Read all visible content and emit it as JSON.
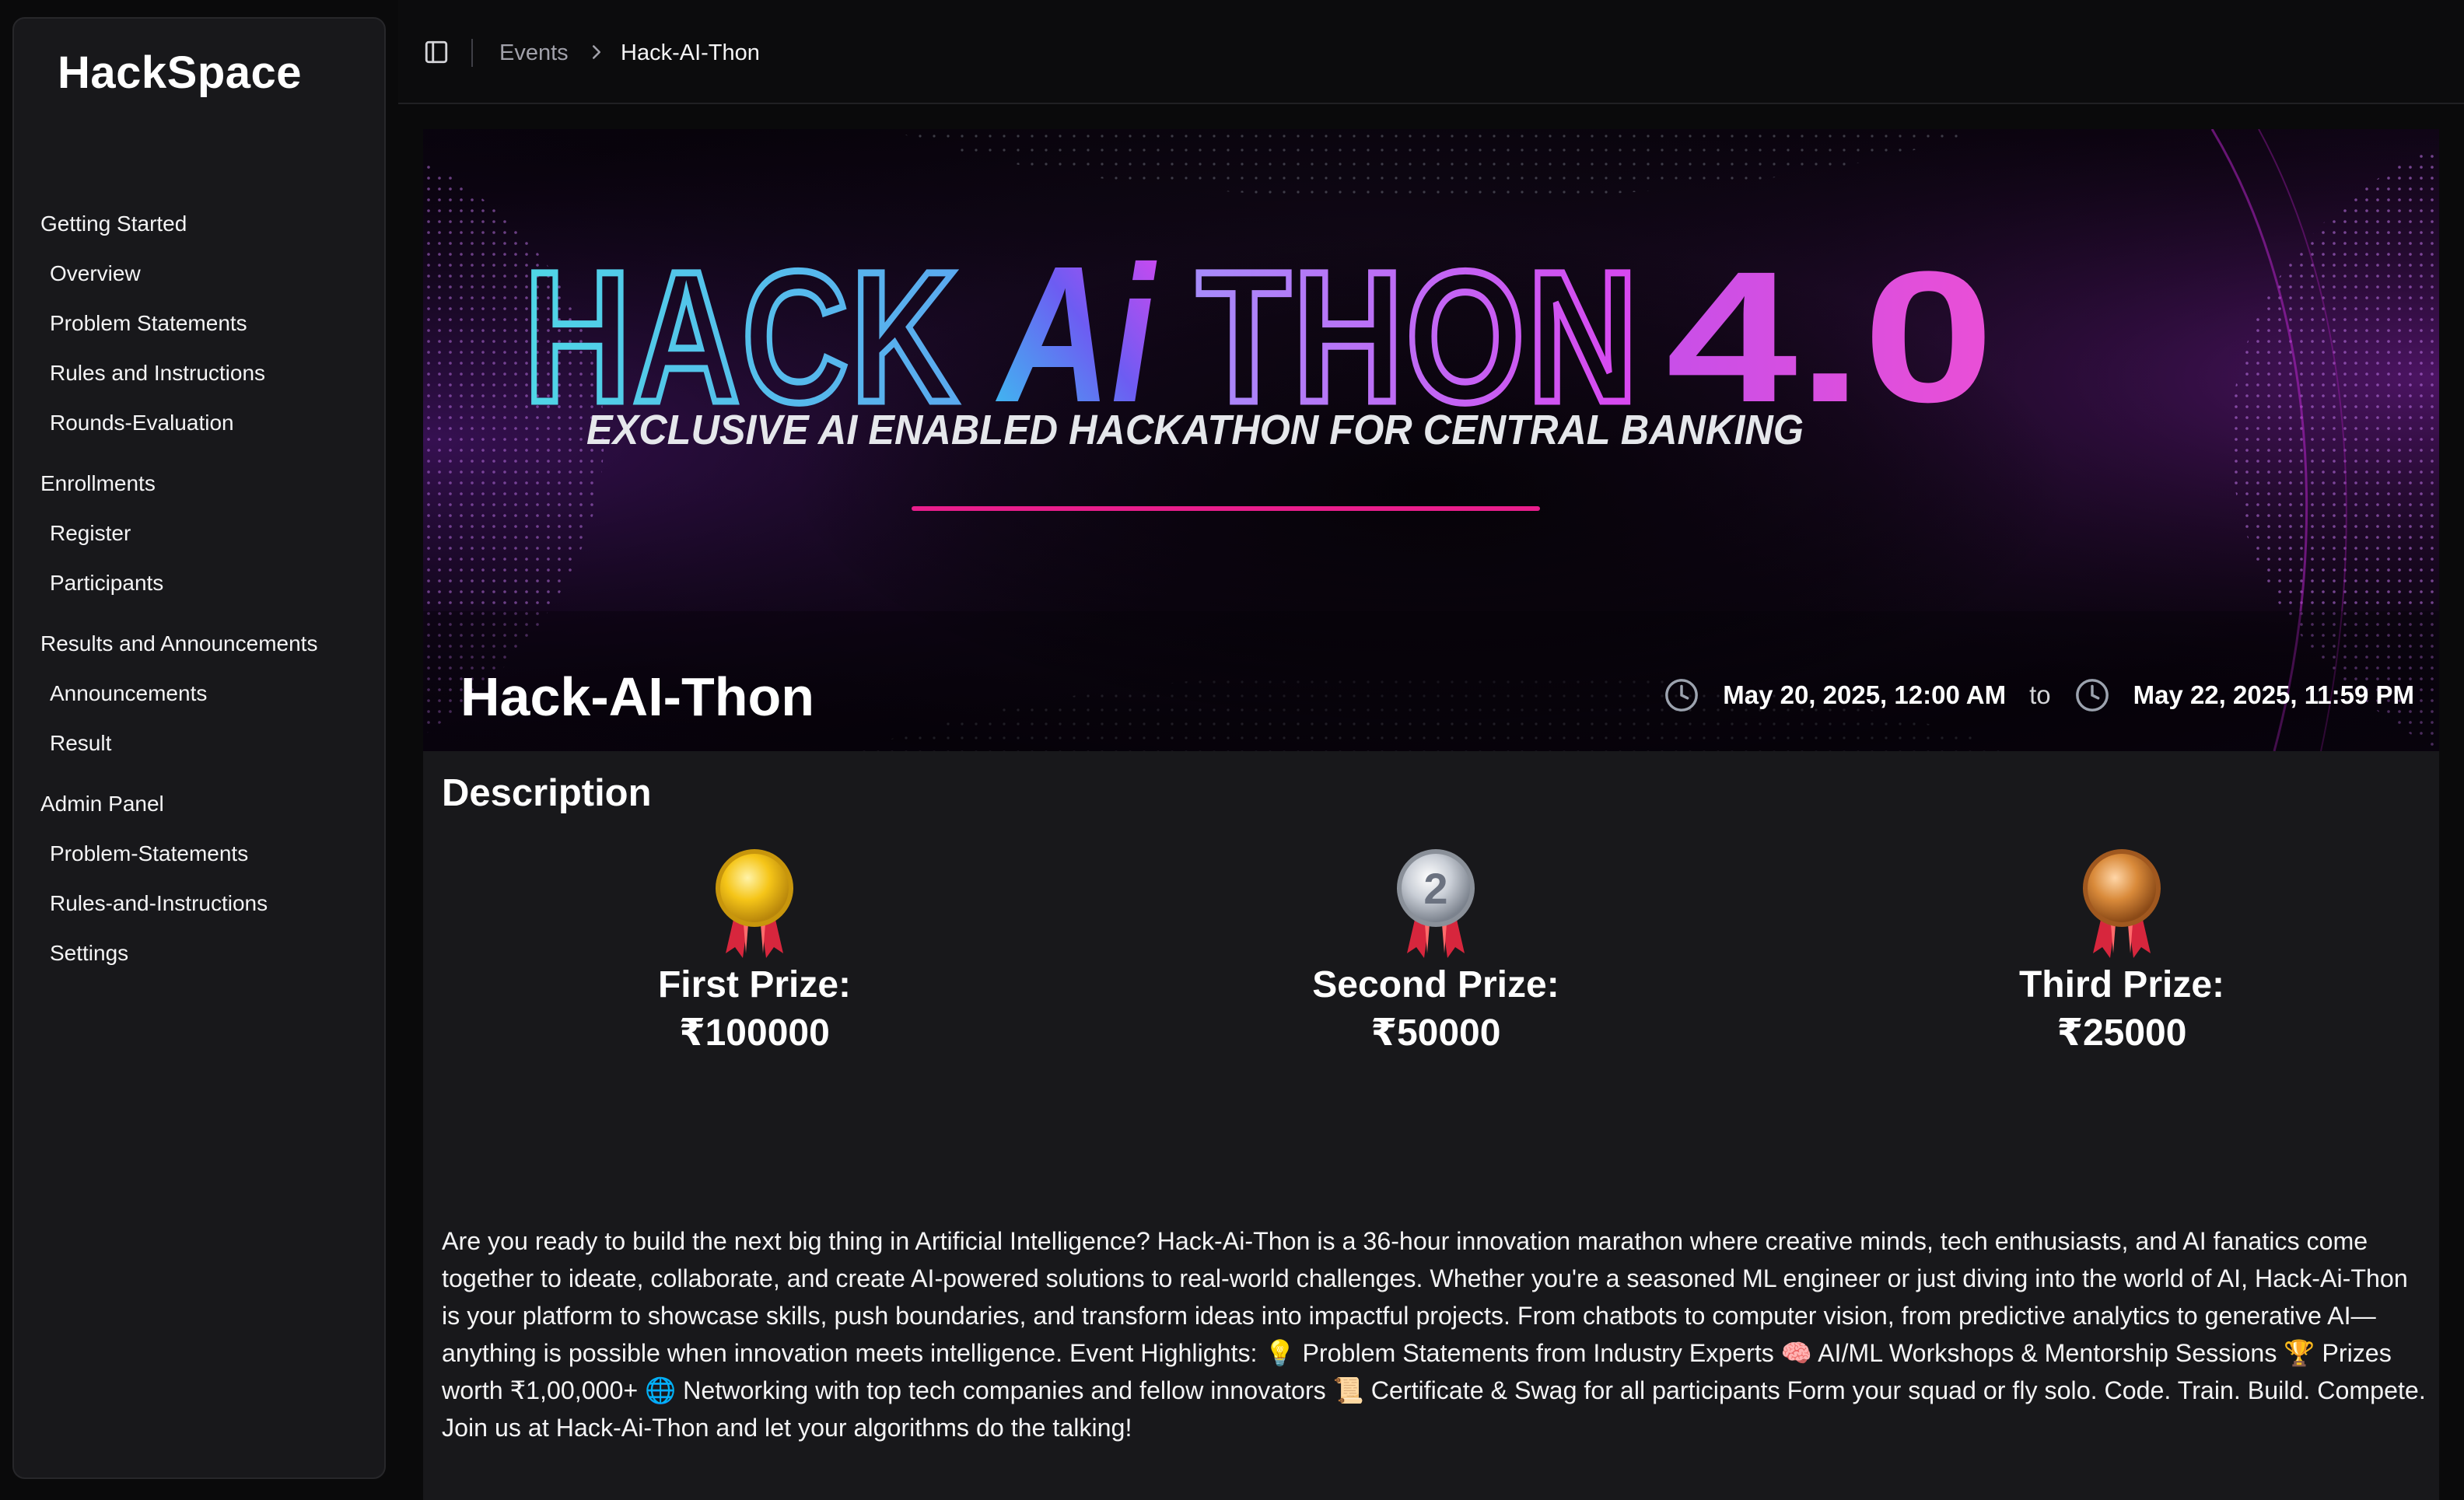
{
  "brand": "HackSpace",
  "sidebar": {
    "groups": [
      {
        "label": "Getting Started",
        "items": [
          "Overview",
          "Problem Statements",
          "Rules and Instructions",
          "Rounds-Evaluation"
        ]
      },
      {
        "label": "Enrollments",
        "items": [
          "Register",
          "Participants"
        ]
      },
      {
        "label": "Results and Announcements",
        "items": [
          "Announcements",
          "Result"
        ]
      },
      {
        "label": "Admin Panel",
        "items": [
          "Problem-Statements",
          "Rules-and-Instructions",
          "Settings"
        ]
      }
    ]
  },
  "header": {
    "breadcrumb": {
      "parent": "Events",
      "current": "Hack-AI-Thon"
    }
  },
  "banner": {
    "logo_parts": [
      "HACK",
      "Ai",
      "THON",
      "4.0"
    ],
    "tagline": "EXCLUSIVE AI ENABLED HACKATHON FOR CENTRAL BANKING"
  },
  "event": {
    "title": "Hack-AI-Thon",
    "start": "May 20, 2025, 12:00 AM",
    "to": "to",
    "end": "May 22, 2025, 11:59 PM"
  },
  "description": {
    "heading": "Description",
    "prizes": [
      {
        "label": "First Prize:",
        "amount": "₹100000",
        "medal": "gold-medal-icon"
      },
      {
        "label": "Second Prize:",
        "amount": "₹50000",
        "medal": "silver-medal-icon",
        "medal_number": "2"
      },
      {
        "label": "Third Prize:",
        "amount": "₹25000",
        "medal": "bronze-medal-icon"
      }
    ],
    "text": "Are you ready to build the next big thing in Artificial Intelligence? Hack-Ai-Thon is a 36-hour innovation marathon where creative minds, tech enthusiasts, and AI fanatics come together to ideate, collaborate, and create AI-powered solutions to real-world challenges. Whether you're a seasoned ML engineer or just diving into the world of AI, Hack-Ai-Thon is your platform to showcase skills, push boundaries, and transform ideas into impactful projects. From chatbots to computer vision, from predictive analytics to generative AI—anything is possible when innovation meets intelligence. Event Highlights: 💡 Problem Statements from Industry Experts 🧠 AI/ML Workshops & Mentorship Sessions 🏆 Prizes worth ₹1,00,000+ 🌐 Networking with top tech companies and fellow innovators 📜 Certificate & Swag for all participants Form your squad or fly solo. Code. Train. Build. Compete. Join us at Hack-Ai-Thon and let your algorithms do the talking!"
  },
  "colors": {
    "sidebar_bg": "#18181b",
    "content_bg": "#18181b",
    "logo_cyan": "#4fd6e6",
    "logo_purple": "#a855f7",
    "logo_magenta": "#e040d0",
    "accent_line": "#e91e8c"
  }
}
